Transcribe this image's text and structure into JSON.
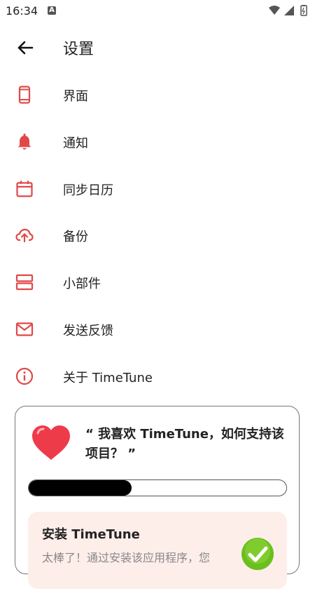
{
  "status_bar": {
    "time": "16:34",
    "app_badge": "A"
  },
  "header": {
    "title": "设置"
  },
  "menu": [
    {
      "label": "界面",
      "icon": "phone-icon"
    },
    {
      "label": "通知",
      "icon": "bell-icon"
    },
    {
      "label": "同步日历",
      "icon": "calendar-icon"
    },
    {
      "label": "备份",
      "icon": "cloud-upload-icon"
    },
    {
      "label": "小部件",
      "icon": "widget-icon"
    },
    {
      "label": "发送反馈",
      "icon": "mail-icon"
    },
    {
      "label": "关于 TimeTune",
      "icon": "info-icon"
    }
  ],
  "support_card": {
    "title": "“ 我喜欢 TimeTune，如何支持该项目？ ”",
    "progress": 0.4,
    "install": {
      "title": "安装 TimeTune",
      "description": "太棒了！通过安装该应用程序，您"
    }
  },
  "colors": {
    "accent": "#e04848",
    "progress": "#000000",
    "install_bg": "#fdeeea"
  }
}
